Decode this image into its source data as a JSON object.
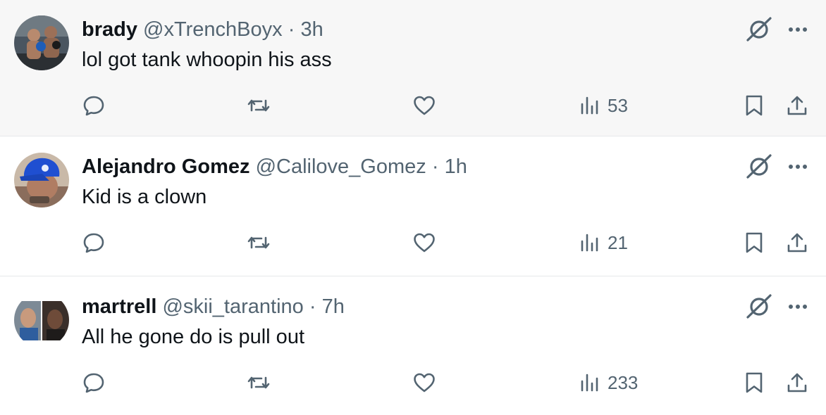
{
  "replies": [
    {
      "display_name": "brady",
      "handle": "@xTrenchBoyx",
      "separator": "·",
      "time": "3h",
      "text": "lol got tank whoopin his ass",
      "views": "53",
      "avatar_icon": "boxing-photo-avatar",
      "highlighted": true
    },
    {
      "display_name": "Alejandro Gomez",
      "handle": "@Calilove_Gomez",
      "separator": "·",
      "time": "1h",
      "text": "Kid is a clown",
      "views": "21",
      "avatar_icon": "blue-cap-photo-avatar",
      "highlighted": false
    },
    {
      "display_name": "martrell",
      "handle": "@skii_tarantino",
      "separator": "·",
      "time": "7h",
      "text": "All he gone do is pull out",
      "views": "233",
      "avatar_icon": "two-faces-photo-avatar",
      "highlighted": false
    }
  ],
  "icons": {
    "reply": "reply-bubble-icon",
    "retweet": "retweet-icon",
    "like": "heart-icon",
    "views": "views-bar-chart-icon",
    "bookmark": "bookmark-icon",
    "share": "share-upload-icon",
    "grok": "grok-icon",
    "more": "more-dots-icon"
  },
  "colors": {
    "text_primary": "#0f1419",
    "text_secondary": "#536471",
    "hover_background": "#f7f7f7",
    "divider": "#e6e8ea"
  }
}
